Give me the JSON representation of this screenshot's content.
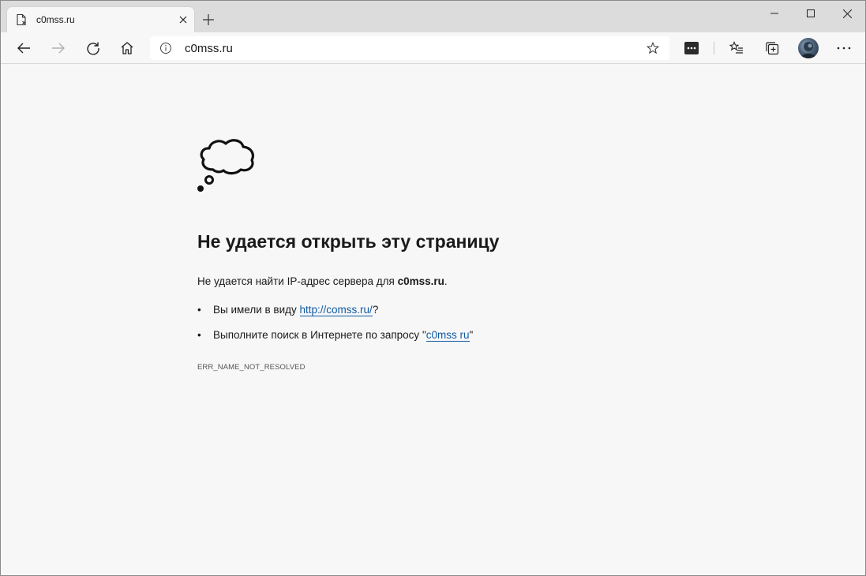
{
  "tab": {
    "title": "c0mss.ru"
  },
  "address_bar": {
    "url": "c0mss.ru"
  },
  "error_page": {
    "headline": "Не удается открыть эту страницу",
    "desc_prefix": "Не удается найти IP-адрес сервера для ",
    "desc_host": "c0mss.ru",
    "desc_suffix": ".",
    "bullet1_prefix": "Вы имели в виду ",
    "bullet1_link": "http://comss.ru/",
    "bullet1_suffix": "?",
    "bullet2_prefix": "Выполните поиск в Интернете по запросу \"",
    "bullet2_link": "c0mss ru",
    "bullet2_suffix": "\"",
    "error_code": "ERR_NAME_NOT_RESOLVED",
    "bullet_char": "•"
  },
  "icons": {
    "tab": "page-error-icon",
    "cloud": "thought-cloud-icon"
  },
  "colors": {
    "link": "#0f5aa3",
    "tabstrip": "#dcdcdc",
    "page_background": "#f7f7f7"
  }
}
